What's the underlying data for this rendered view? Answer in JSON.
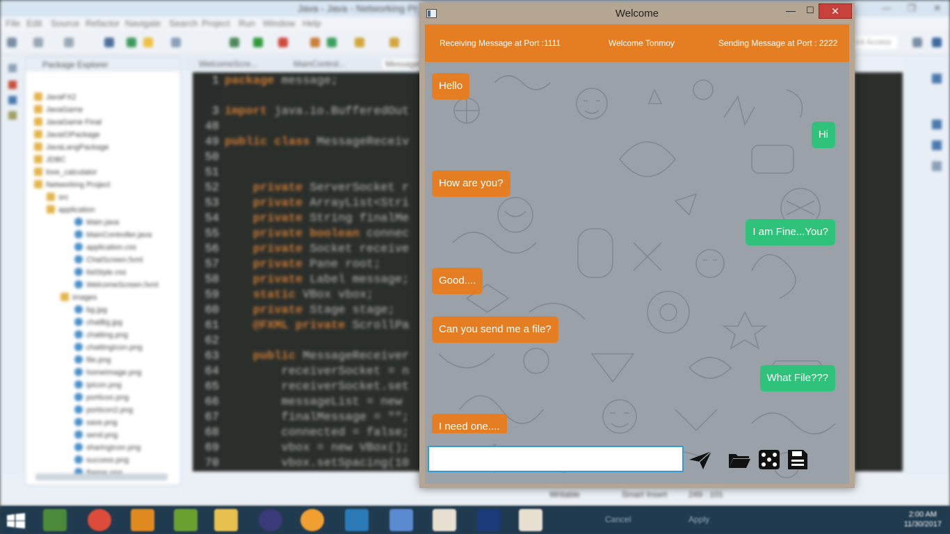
{
  "ide": {
    "title": "Java - Java - Networking Pr",
    "window_controls": [
      "—",
      "❐",
      "✕"
    ],
    "menu": [
      "File",
      "Edit",
      "Source",
      "Refactor",
      "Navigate",
      "Search",
      "Project",
      "Run",
      "Window",
      "Help"
    ],
    "quick_access": "ick Access",
    "package_explorer": {
      "title": "Package Explorer",
      "items": [
        {
          "label": "JavaFX2",
          "kind": "project"
        },
        {
          "label": "JavaGame",
          "kind": "project"
        },
        {
          "label": "JavaGame Final",
          "kind": "project"
        },
        {
          "label": "JavaIOPackage",
          "kind": "project"
        },
        {
          "label": "JavaLangPackage",
          "kind": "project"
        },
        {
          "label": "JDBC",
          "kind": "project"
        },
        {
          "label": "love_calculator",
          "kind": "project"
        },
        {
          "label": "Networking Project",
          "kind": "project"
        },
        {
          "label": "src",
          "kind": "folder"
        },
        {
          "label": "application",
          "kind": "folder"
        },
        {
          "label": "Main.java",
          "kind": "file"
        },
        {
          "label": "MainController.java",
          "kind": "file"
        },
        {
          "label": "application.css",
          "kind": "file"
        },
        {
          "label": "ChatScreen.fxml",
          "kind": "file"
        },
        {
          "label": "listStyle.css",
          "kind": "file"
        },
        {
          "label": "WelcomeScreen.fxml",
          "kind": "file"
        },
        {
          "label": "images",
          "kind": "folder"
        },
        {
          "label": "bg.jpg",
          "kind": "file"
        },
        {
          "label": "chatBg.jpg",
          "kind": "file"
        },
        {
          "label": "chatting.png",
          "kind": "file"
        },
        {
          "label": "chattingIcon.png",
          "kind": "file"
        },
        {
          "label": "file.png",
          "kind": "file"
        },
        {
          "label": "homeImage.png",
          "kind": "file"
        },
        {
          "label": "ipIcon.png",
          "kind": "file"
        },
        {
          "label": "portIcon.png",
          "kind": "file"
        },
        {
          "label": "portIcon2.png",
          "kind": "file"
        },
        {
          "label": "save.png",
          "kind": "file"
        },
        {
          "label": "send.png",
          "kind": "file"
        },
        {
          "label": "sharingIcon.png",
          "kind": "file"
        },
        {
          "label": "success.png",
          "kind": "file"
        },
        {
          "label": "theme.png",
          "kind": "file"
        }
      ]
    },
    "editor_tabs": [
      "WelcomeScre...",
      "MainControl...",
      "MessageR"
    ],
    "code_lines": [
      {
        "n": "1",
        "kw": "package",
        "rest": " message;"
      },
      {
        "n": "",
        "kw": "",
        "rest": ""
      },
      {
        "n": "3",
        "kw": "import",
        "rest": " java.io.BufferedOut"
      },
      {
        "n": "48",
        "kw": "",
        "rest": ""
      },
      {
        "n": "49",
        "kw": "public class",
        "rest": " MessageReceiv"
      },
      {
        "n": "50",
        "kw": "",
        "rest": ""
      },
      {
        "n": "51",
        "kw": "",
        "rest": ""
      },
      {
        "n": "52",
        "kw": "    private",
        "rest": " ServerSocket r"
      },
      {
        "n": "53",
        "kw": "    private",
        "rest": " ArrayList<Stri"
      },
      {
        "n": "54",
        "kw": "    private",
        "rest": " String finalMe"
      },
      {
        "n": "55",
        "kw": "    private boolean",
        "rest": " connec"
      },
      {
        "n": "56",
        "kw": "    private",
        "rest": " Socket receive"
      },
      {
        "n": "57",
        "kw": "    private",
        "rest": " Pane root;"
      },
      {
        "n": "58",
        "kw": "    private",
        "rest": " Label message;"
      },
      {
        "n": "59",
        "kw": "    static",
        "rest": " VBox vbox;"
      },
      {
        "n": "60",
        "kw": "    private",
        "rest": " Stage stage;"
      },
      {
        "n": "61",
        "kw": "    @FXML private",
        "rest": " ScrollPa"
      },
      {
        "n": "62",
        "kw": "",
        "rest": ""
      },
      {
        "n": "63",
        "kw": "    public",
        "rest": " MessageReceiver"
      },
      {
        "n": "64",
        "kw": "",
        "rest": "        receiverSocket = n"
      },
      {
        "n": "65",
        "kw": "",
        "rest": "        receiverSocket.set"
      },
      {
        "n": "66",
        "kw": "",
        "rest": "        messageList = new"
      },
      {
        "n": "67",
        "kw": "",
        "rest": "        finalMessage = \"\";"
      },
      {
        "n": "68",
        "kw": "",
        "rest": "        connected = false;"
      },
      {
        "n": "69",
        "kw": "",
        "rest": "        vbox = new VBox();"
      },
      {
        "n": "70",
        "kw": "",
        "rest": "        vbox.setSpacing(10"
      }
    ],
    "status": {
      "mode": "Writable",
      "insert": "Smart Insert",
      "position": "249 : 101"
    },
    "taskbar_tray": [
      "Cancel",
      "Apply"
    ],
    "clock": {
      "time": "2:00 AM",
      "date": "11/30/2017"
    }
  },
  "chat_window": {
    "title": "Welcome",
    "controls": {
      "minimize": "—",
      "maximize": "☐",
      "close": "✕"
    },
    "header": {
      "receiving": "Receiving Message at Port :1111",
      "welcome": "Welcome Tonmoy",
      "sending": "Sending Message at Port : 2222"
    },
    "messages": [
      {
        "text": "Hello",
        "side": "received"
      },
      {
        "text": "Hi",
        "side": "sent"
      },
      {
        "text": "How are you?",
        "side": "received"
      },
      {
        "text": "I am Fine...You?",
        "side": "sent"
      },
      {
        "text": "Good....",
        "side": "received"
      },
      {
        "text": "Can you send me a file?",
        "side": "received"
      },
      {
        "text": "What File???",
        "side": "sent"
      },
      {
        "text": "I need one....",
        "side": "received"
      }
    ],
    "input": {
      "value": "",
      "placeholder": ""
    },
    "tools": [
      "send-icon",
      "folder-icon",
      "dice-icon",
      "save-icon"
    ],
    "colors": {
      "header": "#e57e22",
      "received_bubble": "#e57e22",
      "sent_bubble": "#2ec27a",
      "input_border": "#2aa0d8",
      "close_button": "#c7403a"
    }
  }
}
